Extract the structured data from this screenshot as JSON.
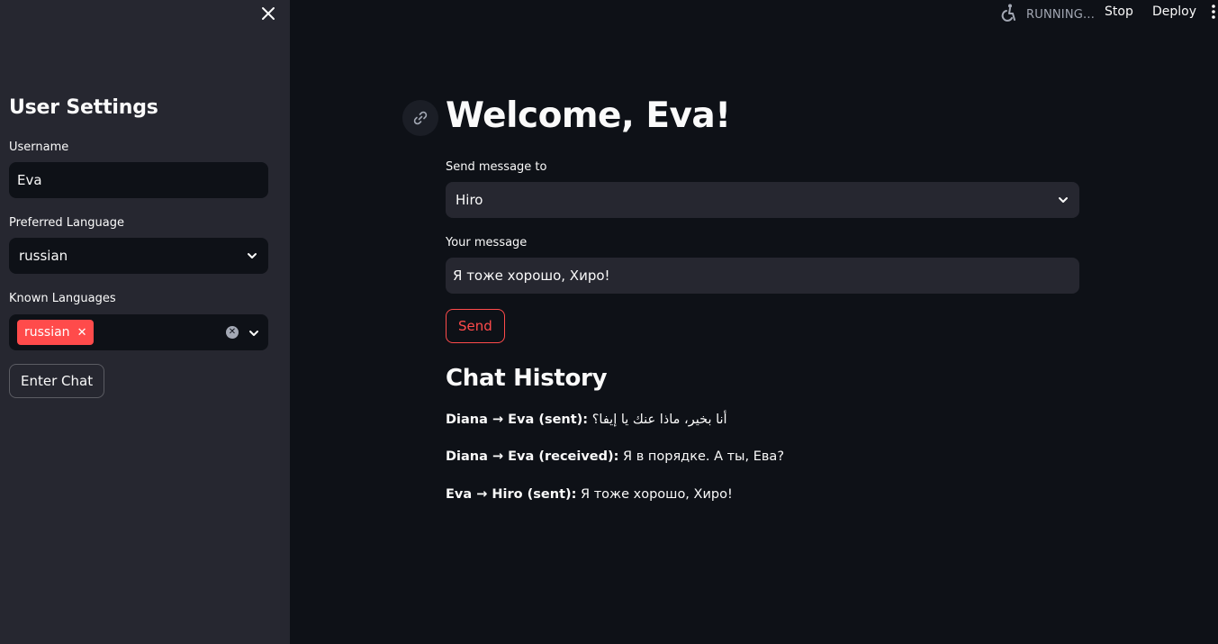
{
  "sidebar": {
    "title": "User Settings",
    "username_label": "Username",
    "username_value": "Eva",
    "preferred_language_label": "Preferred Language",
    "preferred_language_value": "russian",
    "known_languages_label": "Known Languages",
    "known_languages": [
      "russian"
    ],
    "enter_chat_label": "Enter Chat"
  },
  "header": {
    "status": "RUNNING...",
    "stop_label": "Stop",
    "deploy_label": "Deploy"
  },
  "main": {
    "title": "Welcome, Eva!",
    "recipient_label": "Send message to",
    "recipient_value": "Hiro",
    "message_label": "Your message",
    "message_value": "Я тоже хорошо, Хиро!",
    "send_label": "Send",
    "history_title": "Chat History",
    "history": [
      {
        "prefix": "Diana → Eva (sent):",
        "text": "أنا بخير، ماذا عنك يا إيفا؟"
      },
      {
        "prefix": "Diana → Eva (received):",
        "text": "Я в порядке. А ты, Ева?"
      },
      {
        "prefix": "Eva → Hiro (sent):",
        "text": "Я тоже хорошо, Хиро!"
      }
    ]
  },
  "colors": {
    "accent": "#ff4b4b",
    "background": "#0e1117",
    "sidebar": "#262730"
  }
}
